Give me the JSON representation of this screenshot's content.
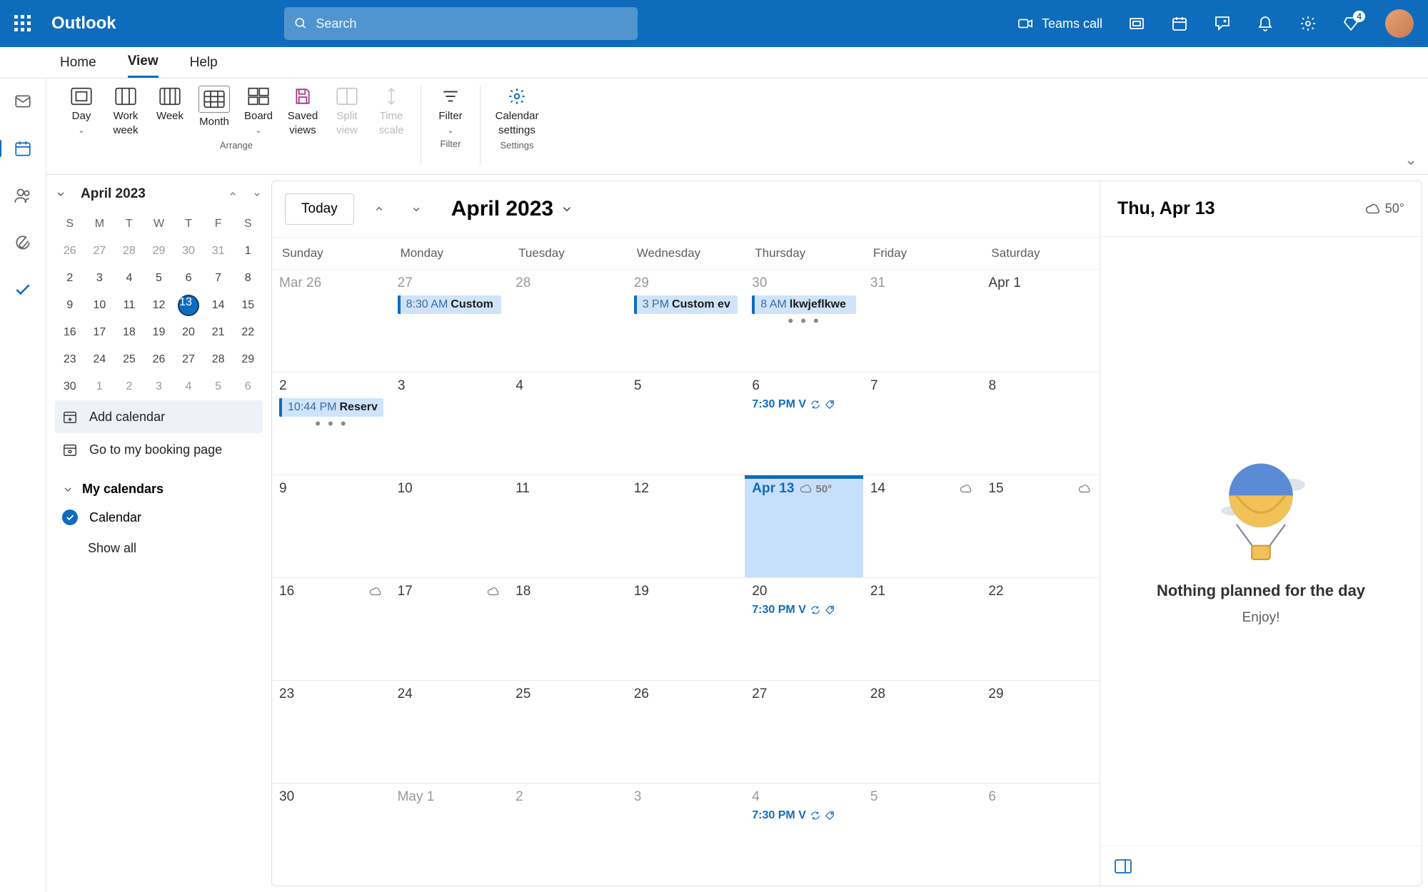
{
  "topbar": {
    "brand": "Outlook",
    "search_placeholder": "Search",
    "teams_call": "Teams call",
    "premium_badge": "4"
  },
  "tabs": {
    "home": "Home",
    "view": "View",
    "help": "Help",
    "active": "view"
  },
  "ribbon": {
    "day": "Day",
    "work_week": "Work week",
    "week": "Week",
    "month": "Month",
    "board": "Board",
    "saved_views": "Saved views",
    "split_view": "Split view",
    "time_scale": "Time scale",
    "filter": "Filter",
    "cal_settings": "Calendar settings",
    "group_arrange": "Arrange",
    "group_filter": "Filter",
    "group_settings": "Settings"
  },
  "minical": {
    "month_label": "April 2023",
    "dow": [
      "S",
      "M",
      "T",
      "W",
      "T",
      "F",
      "S"
    ],
    "rows": [
      [
        {
          "n": "26",
          "dim": true
        },
        {
          "n": "27",
          "dim": true
        },
        {
          "n": "28",
          "dim": true
        },
        {
          "n": "29",
          "dim": true
        },
        {
          "n": "30",
          "dim": true
        },
        {
          "n": "31",
          "dim": true
        },
        {
          "n": "1"
        }
      ],
      [
        {
          "n": "2"
        },
        {
          "n": "3"
        },
        {
          "n": "4"
        },
        {
          "n": "5"
        },
        {
          "n": "6"
        },
        {
          "n": "7"
        },
        {
          "n": "8"
        }
      ],
      [
        {
          "n": "9"
        },
        {
          "n": "10"
        },
        {
          "n": "11"
        },
        {
          "n": "12"
        },
        {
          "n": "13",
          "today": true
        },
        {
          "n": "14"
        },
        {
          "n": "15"
        }
      ],
      [
        {
          "n": "16"
        },
        {
          "n": "17"
        },
        {
          "n": "18"
        },
        {
          "n": "19"
        },
        {
          "n": "20"
        },
        {
          "n": "21"
        },
        {
          "n": "22"
        }
      ],
      [
        {
          "n": "23"
        },
        {
          "n": "24"
        },
        {
          "n": "25"
        },
        {
          "n": "26"
        },
        {
          "n": "27"
        },
        {
          "n": "28"
        },
        {
          "n": "29"
        }
      ],
      [
        {
          "n": "30"
        },
        {
          "n": "1",
          "dim": true
        },
        {
          "n": "2",
          "dim": true
        },
        {
          "n": "3",
          "dim": true
        },
        {
          "n": "4",
          "dim": true
        },
        {
          "n": "5",
          "dim": true
        },
        {
          "n": "6",
          "dim": true
        }
      ]
    ]
  },
  "sidebar": {
    "add_calendar": "Add calendar",
    "booking": "Go to my booking page",
    "my_calendars": "My calendars",
    "calendar_item": "Calendar",
    "show_all": "Show all"
  },
  "calhdr": {
    "today": "Today",
    "title": "April 2023"
  },
  "dows": [
    "Sunday",
    "Monday",
    "Tuesday",
    "Wednesday",
    "Thursday",
    "Friday",
    "Saturday"
  ],
  "weeks": [
    [
      {
        "label": "Mar 26",
        "grey": true
      },
      {
        "label": "27",
        "grey": true,
        "ev": {
          "time": "8:30 AM",
          "title": "Custom"
        }
      },
      {
        "label": "28",
        "grey": true
      },
      {
        "label": "29",
        "grey": true,
        "ev": {
          "time": "3 PM",
          "title": "Custom ev"
        }
      },
      {
        "label": "30",
        "grey": true,
        "ev": {
          "time": "8 AM",
          "title": "lkwjeflkwe"
        },
        "more": true
      },
      {
        "label": "31",
        "grey": true
      },
      {
        "label": "Apr 1"
      }
    ],
    [
      {
        "label": "2",
        "ev": {
          "time": "10:44 PM",
          "title": "Reserv"
        },
        "more": true
      },
      {
        "label": "3"
      },
      {
        "label": "4"
      },
      {
        "label": "5"
      },
      {
        "label": "6",
        "evtext": "7:30 PM V",
        "recur": true,
        "tag": true
      },
      {
        "label": "7"
      },
      {
        "label": "8"
      }
    ],
    [
      {
        "label": "9"
      },
      {
        "label": "10"
      },
      {
        "label": "11"
      },
      {
        "label": "12"
      },
      {
        "label": "Apr 13",
        "today": true,
        "wx": "50°"
      },
      {
        "label": "14",
        "wxicon": true
      },
      {
        "label": "15",
        "wxicon": true
      }
    ],
    [
      {
        "label": "16",
        "wxicon": true
      },
      {
        "label": "17",
        "wxicon": true
      },
      {
        "label": "18"
      },
      {
        "label": "19"
      },
      {
        "label": "20",
        "evtext": "7:30 PM V",
        "recur": true,
        "tag": true
      },
      {
        "label": "21"
      },
      {
        "label": "22"
      }
    ],
    [
      {
        "label": "23"
      },
      {
        "label": "24"
      },
      {
        "label": "25"
      },
      {
        "label": "26"
      },
      {
        "label": "27"
      },
      {
        "label": "28"
      },
      {
        "label": "29"
      }
    ],
    [
      {
        "label": "30"
      },
      {
        "label": "May 1",
        "grey": true
      },
      {
        "label": "2",
        "grey": true
      },
      {
        "label": "3",
        "grey": true
      },
      {
        "label": "4",
        "grey": true,
        "evtext": "7:30 PM V",
        "recur": true,
        "tag": true
      },
      {
        "label": "5",
        "grey": true
      },
      {
        "label": "6",
        "grey": true
      }
    ]
  ],
  "agenda": {
    "date": "Thu, Apr 13",
    "wx": "50°",
    "empty_title": "Nothing planned for the day",
    "empty_sub": "Enjoy!"
  }
}
